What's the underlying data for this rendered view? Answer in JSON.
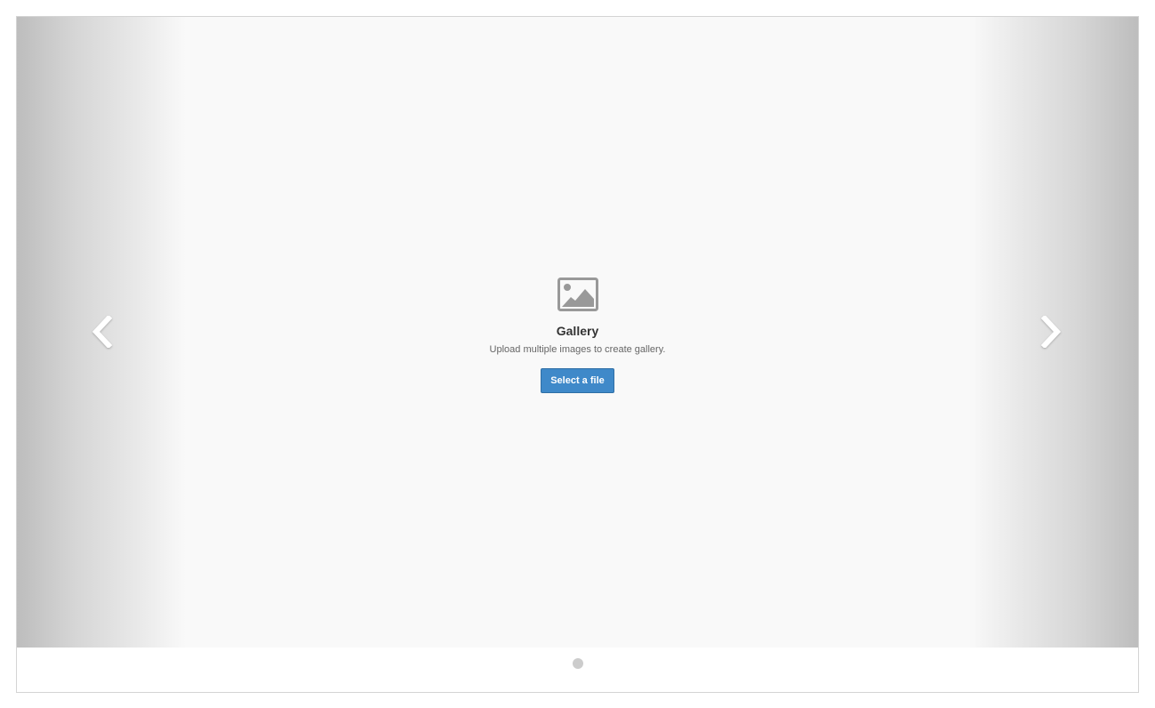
{
  "gallery": {
    "icon": "image-icon",
    "title": "Gallery",
    "description": "Upload multiple images to create gallery.",
    "select_button_label": "Select a file",
    "button_color": "#3f89c9",
    "prev_icon": "chevron-left-icon",
    "next_icon": "chevron-right-icon",
    "pager": {
      "slides": 1,
      "active": 1
    }
  }
}
